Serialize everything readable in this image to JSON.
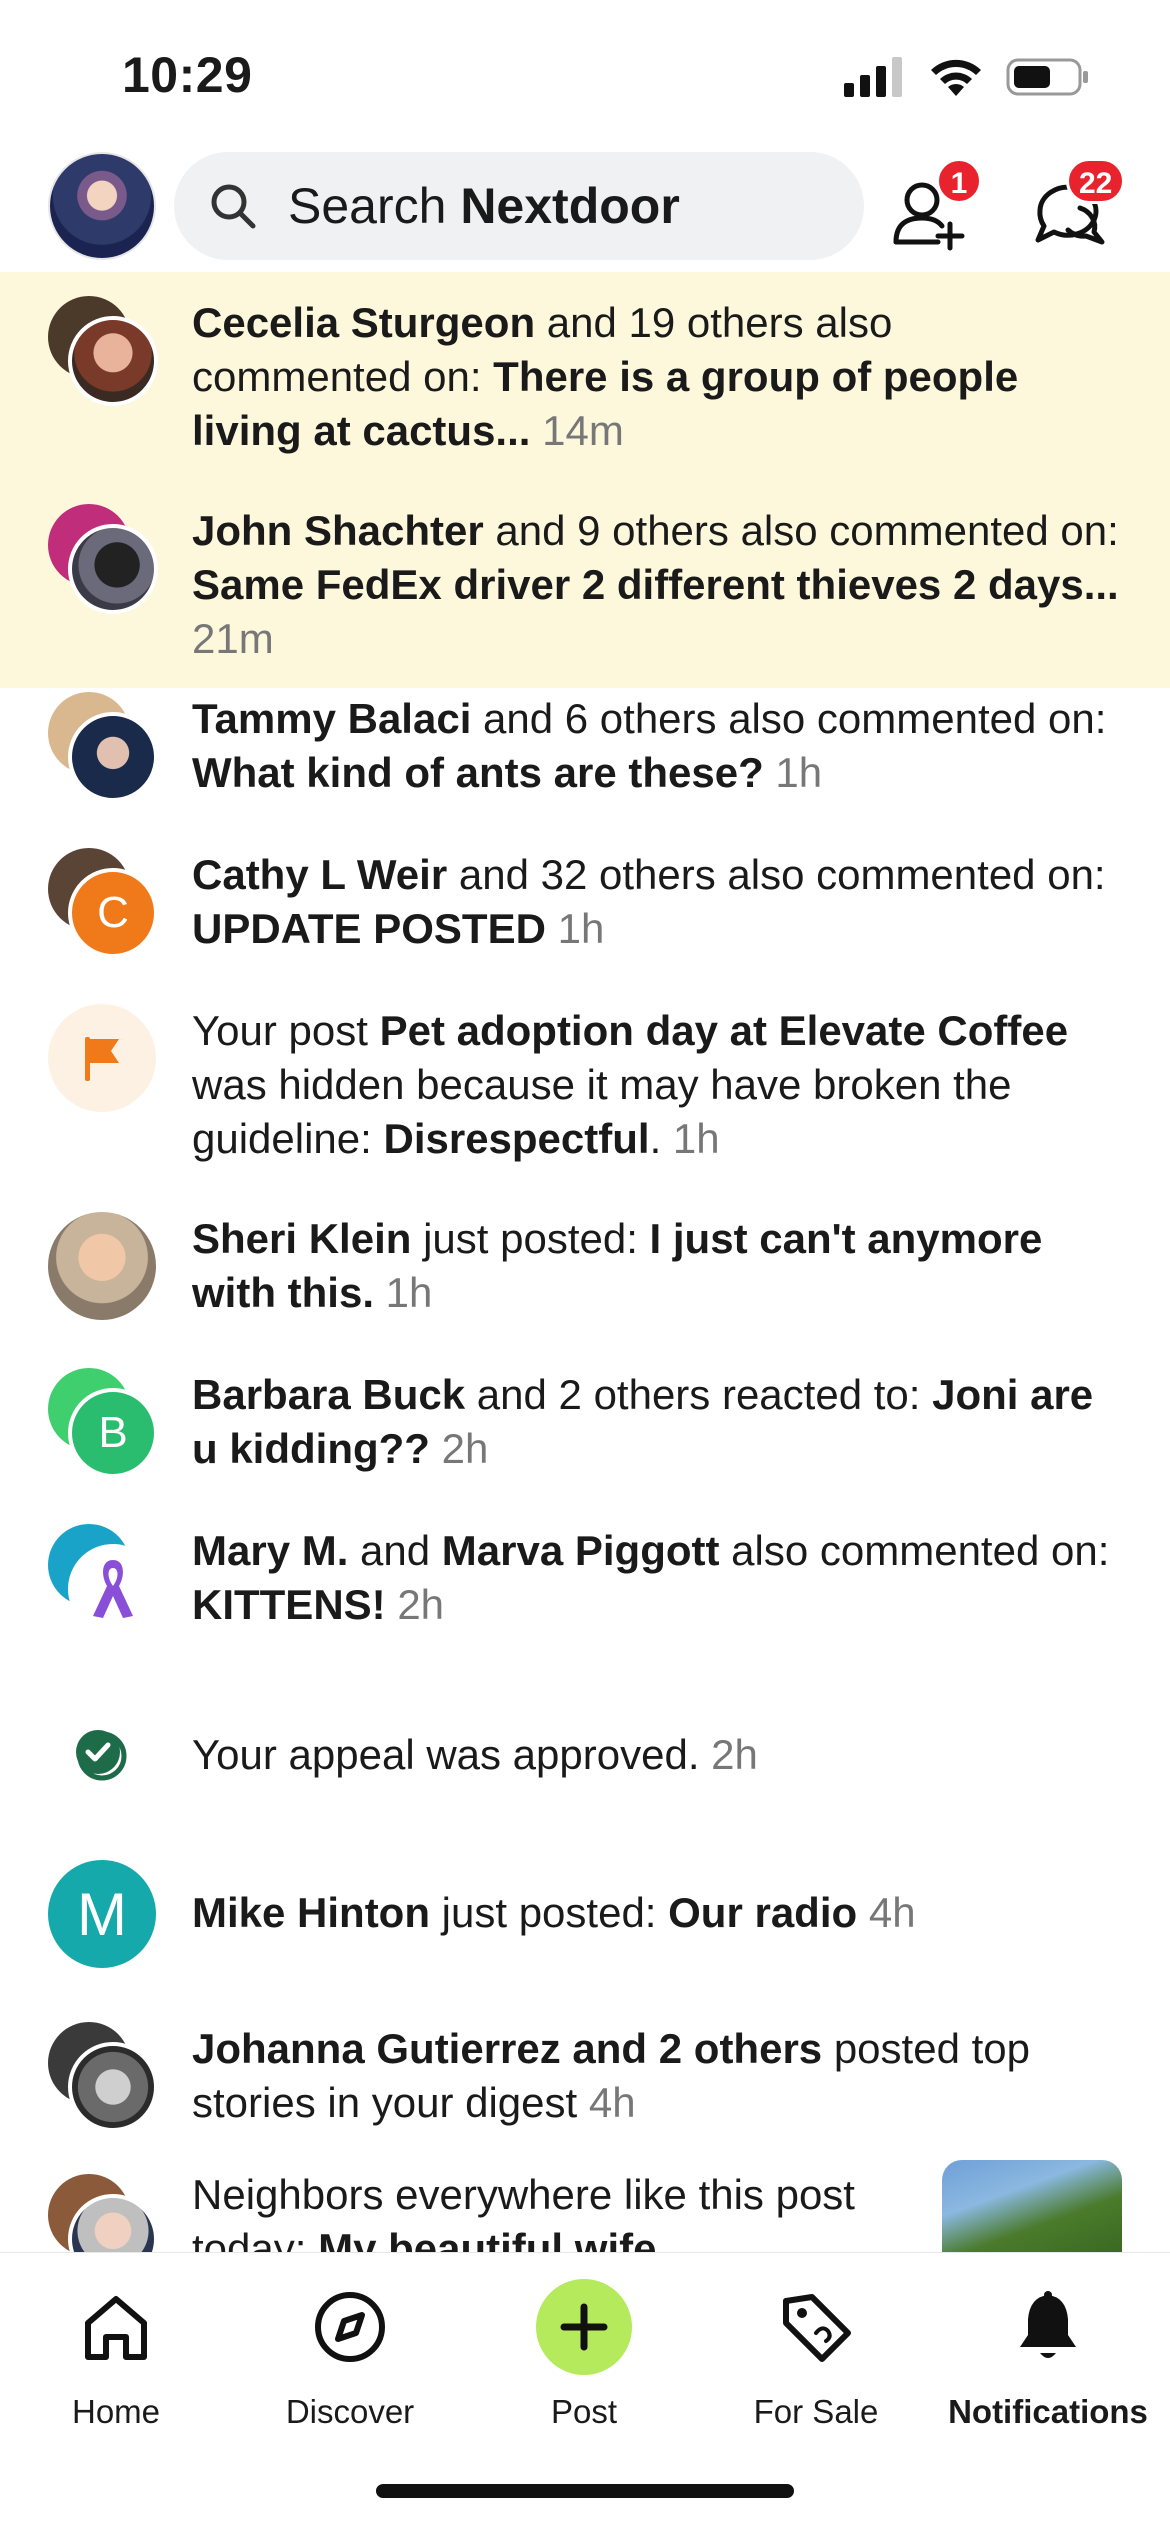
{
  "status_bar": {
    "time": "10:29"
  },
  "header": {
    "search_prefix": "Search ",
    "search_brand": "Nextdoor",
    "connections_badge": "1",
    "messages_badge": "22"
  },
  "notifications": [
    {
      "actor": "Cecelia Sturgeon",
      "mid": " and 19 others also commented on: ",
      "target": "There is a group of people living at cactus...",
      "time": " 14m"
    },
    {
      "actor": "John Shachter",
      "mid": " and 9 others also commented on: ",
      "target": "Same FedEx driver 2 different thieves 2 days...",
      "time": " 21m"
    },
    {
      "actor": "Tammy Balaci",
      "mid": " and 6 others also commented on: ",
      "target": "What kind of ants are these?",
      "time": " 1h"
    },
    {
      "actor": "Cathy L Weir",
      "mid": " and 32 others also commented on: ",
      "target": "UPDATE POSTED",
      "time": " 1h",
      "avatar_letter": "C"
    },
    {
      "pre": "Your post ",
      "bold1": "Pet adoption day at Elevate Coffee",
      "mid": " was hidden because it may have broken the guideline: ",
      "bold2": "Disrespectful",
      "post": ".",
      "time": " 1h"
    },
    {
      "actor": "Sheri Klein",
      "mid": " just posted: ",
      "target": "I just can't anymore with this.",
      "time": " 1h"
    },
    {
      "actor": "Barbara Buck",
      "mid": " and 2 others reacted to: ",
      "target": "Joni are u kidding??",
      "time": " 2h",
      "avatar_letter": "B"
    },
    {
      "actor": "Mary M.",
      "and": " and ",
      "actor2": "Marva Piggott",
      "mid": " also commented on: ",
      "target": "KITTENS!",
      "time": " 2h"
    },
    {
      "text": "Your appeal was approved.",
      "time": " 2h"
    },
    {
      "actor": "Mike Hinton",
      "mid": " just posted: ",
      "target": "Our radio",
      "time": " 4h",
      "avatar_letter": "M"
    },
    {
      "actor": "Johanna Gutierrez and 2 others",
      "mid": " posted top stories in your digest",
      "time": " 4h"
    },
    {
      "pre": "Neighbors everywhere like this post today: ",
      "target": "My beautiful wife"
    }
  ],
  "nav": {
    "home": "Home",
    "discover": "Discover",
    "post": "Post",
    "for_sale": "For Sale",
    "notifications": "Notifications"
  },
  "colors": {
    "highlight": "#fdf8dc",
    "badge": "#e8232d",
    "post_button": "#b5ea5c",
    "orange_avatar": "#f07a1a",
    "green_avatar": "#2bbd6f",
    "teal_avatar": "#16a9ab"
  }
}
